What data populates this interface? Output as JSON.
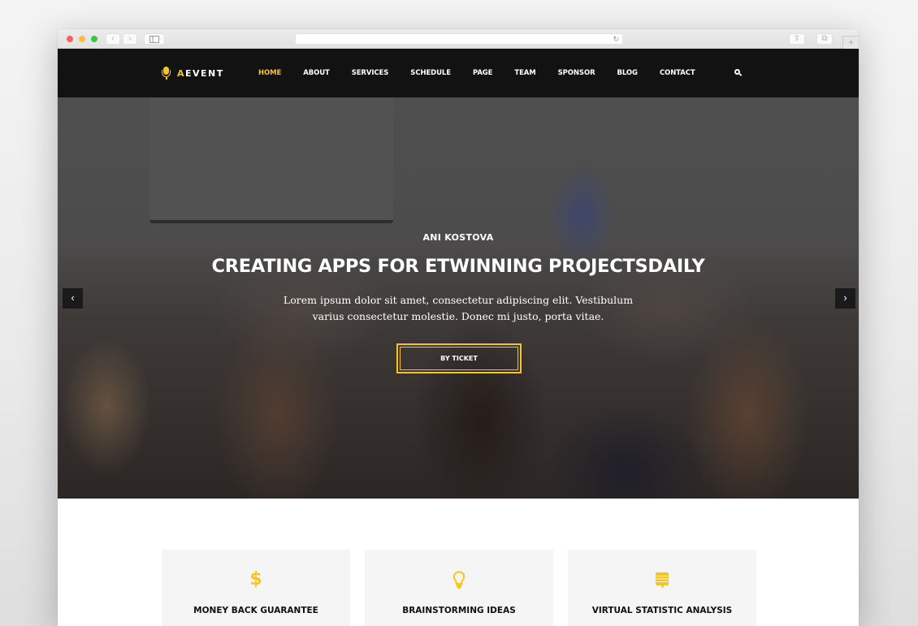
{
  "browser": {
    "back_icon": "‹",
    "forward_icon": "›",
    "reload_icon": "↻",
    "share_icon": "⇪",
    "tabs_icon": "⧉",
    "new_tab_icon": "+"
  },
  "header": {
    "logo": {
      "accent_letter": "A",
      "rest": "EVENT"
    },
    "nav": [
      {
        "label": "HOME",
        "active": true
      },
      {
        "label": "ABOUT"
      },
      {
        "label": "SERVICES"
      },
      {
        "label": "SCHEDULE"
      },
      {
        "label": "PAGE"
      },
      {
        "label": "TEAM"
      },
      {
        "label": "SPONSOR"
      },
      {
        "label": "BLOG"
      },
      {
        "label": "CONTACT"
      }
    ]
  },
  "hero": {
    "eyebrow": "ANI KOSTOVA",
    "title": "CREATING APPS FOR ETWINNING PROJECTSDAILY",
    "description": "Lorem ipsum dolor sit amet, consectetur adipiscing elit. Vestibulum varius consectetur molestie. Donec mi justo, porta vitae.",
    "button_label": "BY TICKET",
    "prev_icon": "‹",
    "next_icon": "›"
  },
  "features": [
    {
      "icon": "dollar-icon",
      "glyph": "$",
      "title": "MONEY BACK GUARANTEE"
    },
    {
      "icon": "lightbulb-icon",
      "title": "BRAINSTORMING IDEAS"
    },
    {
      "icon": "chat-list-icon",
      "title": "VIRTUAL STATISTIC ANALYSIS"
    }
  ],
  "colors": {
    "accent": "#f6c523",
    "header_bg": "#121212",
    "card_bg": "#f5f5f5"
  }
}
